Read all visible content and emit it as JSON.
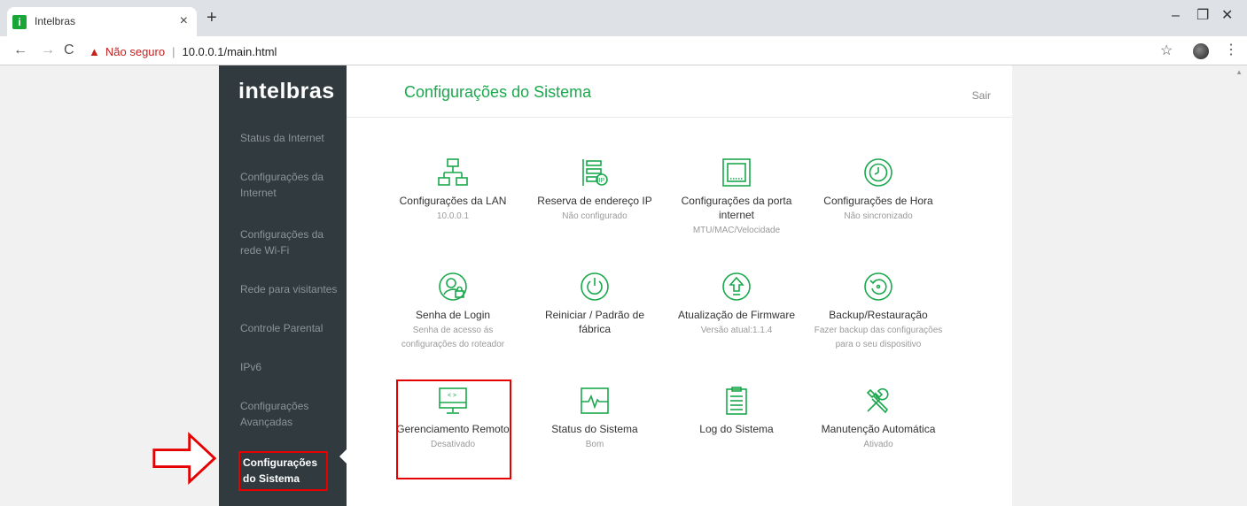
{
  "browser": {
    "tab_title": "Intelbras",
    "favicon_letter": "i",
    "security_label": "Não seguro",
    "url": "10.0.0.1/main.html"
  },
  "sidebar": {
    "logo": "intelbras",
    "items": [
      {
        "label": "Status da Internet"
      },
      {
        "label": "Configurações da Internet"
      },
      {
        "label": "Configurações da rede Wi-Fi"
      },
      {
        "label": "Rede para visitantes"
      },
      {
        "label": "Controle Parental"
      },
      {
        "label": "IPv6"
      },
      {
        "label": "Configurações Avançadas"
      },
      {
        "label": "Configurações do Sistema"
      }
    ]
  },
  "main": {
    "title": "Configurações do Sistema",
    "logout": "Sair",
    "tiles": [
      {
        "title": "Configurações da LAN",
        "sub": "10.0.0.1",
        "icon": "network-icon"
      },
      {
        "title": "Reserva de endereço IP",
        "sub": "Não configurado",
        "icon": "ip-reservation-icon"
      },
      {
        "title": "Configurações da porta internet",
        "sub": "MTU/MAC/Velocidade",
        "icon": "ethernet-port-icon"
      },
      {
        "title": "Configurações de Hora",
        "sub": "Não sincronizado",
        "icon": "clock-icon"
      },
      {
        "title": "Senha de Login",
        "sub": "Senha de acesso ás configurações do roteador",
        "icon": "user-lock-icon"
      },
      {
        "title": "Reiniciar / Padrão de fábrica",
        "sub": "",
        "icon": "power-icon"
      },
      {
        "title": "Atualização de Firmware",
        "sub": "Versão atual:1.1.4",
        "icon": "upgrade-icon"
      },
      {
        "title": "Backup/Restauração",
        "sub": "Fazer backup das configurações para o seu dispositivo",
        "icon": "restore-icon"
      },
      {
        "title": "Gerenciamento Remoto",
        "sub": "Desativado",
        "icon": "remote-monitor-icon"
      },
      {
        "title": "Status do Sistema",
        "sub": "Bom",
        "icon": "heartbeat-icon"
      },
      {
        "title": "Log do Sistema",
        "sub": "",
        "icon": "clipboard-list-icon"
      },
      {
        "title": "Manutenção Automática",
        "sub": "Ativado",
        "icon": "tools-icon"
      }
    ]
  },
  "colors": {
    "accent": "#1aa84d",
    "sidebar_bg": "#313a3e",
    "highlight": "#e60000"
  }
}
